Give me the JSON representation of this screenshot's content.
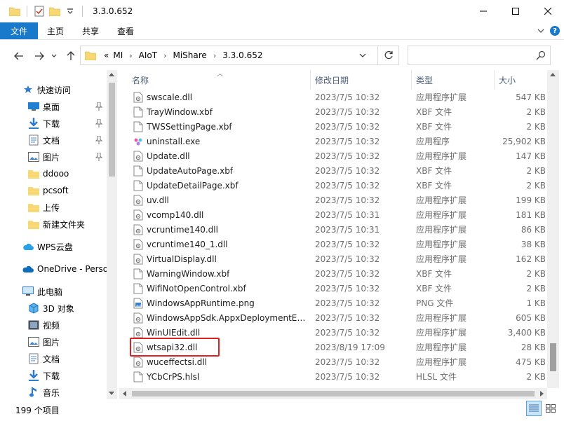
{
  "window": {
    "title": "3.3.0.652"
  },
  "ribbon": {
    "tabs": [
      "文件",
      "主页",
      "共享",
      "查看"
    ]
  },
  "address": {
    "overflow": "«",
    "crumbs": [
      "MI",
      "AIoT",
      "MiShare",
      "3.3.0.652"
    ]
  },
  "search": {
    "placeholder": ""
  },
  "navpane": {
    "items": [
      {
        "label": "快速访问",
        "icon": "star-icon",
        "pinned": false
      },
      {
        "label": "桌面",
        "icon": "desktop-icon",
        "pinned": true
      },
      {
        "label": "下载",
        "icon": "download-icon",
        "pinned": true
      },
      {
        "label": "文档",
        "icon": "document-icon",
        "pinned": true
      },
      {
        "label": "图片",
        "icon": "picture-icon",
        "pinned": true
      },
      {
        "label": "ddooo",
        "icon": "folder-icon",
        "pinned": false
      },
      {
        "label": "pcsoft",
        "icon": "folder-icon",
        "pinned": false
      },
      {
        "label": "上传",
        "icon": "folder-icon",
        "pinned": false
      },
      {
        "label": "新建文件夹",
        "icon": "folder-icon",
        "pinned": false
      },
      {
        "label": "WPS云盘",
        "icon": "cloud-icon",
        "pinned": false
      },
      {
        "label": "OneDrive - Perso",
        "icon": "onedrive-icon",
        "pinned": false
      },
      {
        "label": "此电脑",
        "icon": "computer-icon",
        "pinned": false
      },
      {
        "label": "3D 对象",
        "icon": "3d-objects-icon",
        "pinned": false
      },
      {
        "label": "视频",
        "icon": "video-icon",
        "pinned": false
      },
      {
        "label": "图片",
        "icon": "picture-icon",
        "pinned": false
      },
      {
        "label": "文档",
        "icon": "document-icon",
        "pinned": false
      },
      {
        "label": "下载",
        "icon": "download-icon",
        "pinned": false
      },
      {
        "label": "音乐",
        "icon": "music-icon",
        "pinned": false
      }
    ]
  },
  "columns": {
    "name": "名称",
    "date": "修改日期",
    "type": "类型",
    "size": "大小"
  },
  "files": [
    {
      "name": "swscale.dll",
      "date": "2023/7/5 10:32",
      "type": "应用程序扩展",
      "size": "547 KB",
      "icon": "dll"
    },
    {
      "name": "TrayWindow.xbf",
      "date": "2023/7/5 10:32",
      "type": "XBF 文件",
      "size": "2 KB",
      "icon": "file"
    },
    {
      "name": "TWSSettingPage.xbf",
      "date": "2023/7/5 10:32",
      "type": "XBF 文件",
      "size": "2 KB",
      "icon": "file"
    },
    {
      "name": "uninstall.exe",
      "date": "2023/7/5 10:32",
      "type": "应用程序",
      "size": "25,902 KB",
      "icon": "exe"
    },
    {
      "name": "Update.dll",
      "date": "2023/7/5 10:32",
      "type": "应用程序扩展",
      "size": "147 KB",
      "icon": "dll"
    },
    {
      "name": "UpdateAutoPage.xbf",
      "date": "2023/7/5 10:32",
      "type": "XBF 文件",
      "size": "2 KB",
      "icon": "file"
    },
    {
      "name": "UpdateDetailPage.xbf",
      "date": "2023/7/5 10:32",
      "type": "XBF 文件",
      "size": "2 KB",
      "icon": "file"
    },
    {
      "name": "uv.dll",
      "date": "2023/7/5 10:32",
      "type": "应用程序扩展",
      "size": "199 KB",
      "icon": "dll"
    },
    {
      "name": "vcomp140.dll",
      "date": "2023/7/5 10:31",
      "type": "应用程序扩展",
      "size": "181 KB",
      "icon": "dll"
    },
    {
      "name": "vcruntime140.dll",
      "date": "2023/7/5 10:31",
      "type": "应用程序扩展",
      "size": "86 KB",
      "icon": "dll"
    },
    {
      "name": "vcruntime140_1.dll",
      "date": "2023/7/5 10:32",
      "type": "应用程序扩展",
      "size": "38 KB",
      "icon": "dll"
    },
    {
      "name": "VirtualDisplay.dll",
      "date": "2023/7/5 10:32",
      "type": "应用程序扩展",
      "size": "162 KB",
      "icon": "dll"
    },
    {
      "name": "WarningWindow.xbf",
      "date": "2023/7/5 10:32",
      "type": "XBF 文件",
      "size": "2 KB",
      "icon": "file"
    },
    {
      "name": "WifiNotOpenControl.xbf",
      "date": "2023/7/5 10:32",
      "type": "XBF 文件",
      "size": "2 KB",
      "icon": "file"
    },
    {
      "name": "WindowsAppRuntime.png",
      "date": "2023/7/5 10:32",
      "type": "PNG 文件",
      "size": "1 KB",
      "icon": "png"
    },
    {
      "name": "WindowsAppSdk.AppxDeploymentEx...",
      "date": "2023/7/5 10:32",
      "type": "应用程序扩展",
      "size": "605 KB",
      "icon": "dll"
    },
    {
      "name": "WinUIEdit.dll",
      "date": "2023/7/5 10:32",
      "type": "应用程序扩展",
      "size": "3,400 KB",
      "icon": "dll"
    },
    {
      "name": "wtsapi32.dll",
      "date": "2023/8/19 17:09",
      "type": "应用程序扩展",
      "size": "28 KB",
      "icon": "dll"
    },
    {
      "name": "wuceffectsi.dll",
      "date": "2023/7/5 10:32",
      "type": "应用程序扩展",
      "size": "475 KB",
      "icon": "dll"
    },
    {
      "name": "YCbCrPS.hlsl",
      "date": "2023/7/5 10:32",
      "type": "HLSL 文件",
      "size": "2 KB",
      "icon": "file"
    }
  ],
  "status": {
    "count": "199 个项目"
  },
  "colors": {
    "accent": "#1979ca",
    "highlight": "#e02020",
    "folder": "#f8d775"
  }
}
